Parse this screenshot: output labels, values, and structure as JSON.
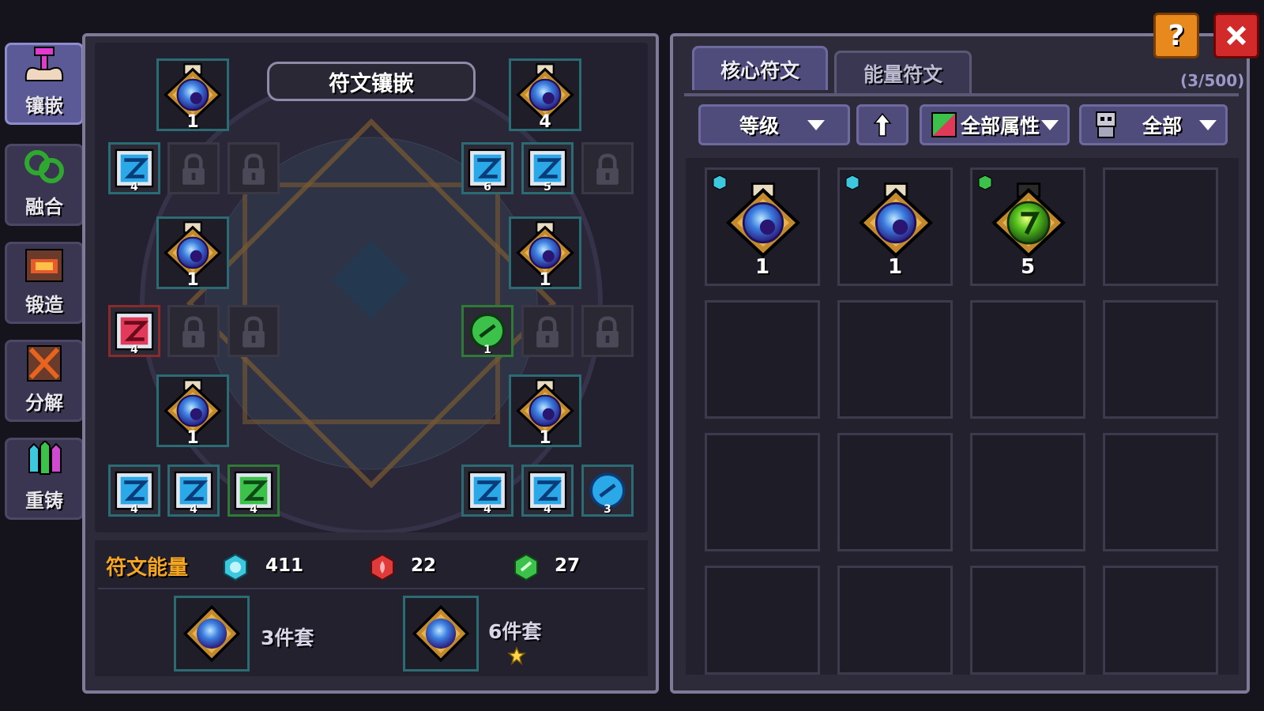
{
  "sidebar": {
    "items": [
      {
        "label": "镶嵌",
        "icon": "inlay-icon",
        "active": true
      },
      {
        "label": "融合",
        "icon": "fusion-icon",
        "active": false
      },
      {
        "label": "锻造",
        "icon": "forge-icon",
        "active": false
      },
      {
        "label": "分解",
        "icon": "decompose-icon",
        "active": false
      },
      {
        "label": "重铸",
        "icon": "recast-icon",
        "active": false
      }
    ]
  },
  "inlay_panel": {
    "title": "符文镶嵌",
    "core_levels": [
      "1",
      "4",
      "1",
      "1",
      "1",
      "1"
    ],
    "slot_levels": {
      "row1_left": [
        "4"
      ],
      "row1_right": [
        "6",
        "5"
      ],
      "row2_left": [
        "4"
      ],
      "row2_right": [
        "1"
      ],
      "row3_left": [
        "4",
        "4",
        "4"
      ],
      "row3_right": [
        "4",
        "4",
        "3"
      ]
    }
  },
  "energy": {
    "label": "符文能量",
    "blue": "411",
    "red": "22",
    "green": "27"
  },
  "sets": [
    {
      "label": "3件套"
    },
    {
      "label": "6件套"
    }
  ],
  "rune_panel": {
    "tabs": [
      {
        "label": "核心符文",
        "active": true
      },
      {
        "label": "能量符文",
        "active": false
      }
    ],
    "count": "(3/500)",
    "filters": {
      "sort": "等级",
      "attribute": "全部属性",
      "type": "全部"
    },
    "runes": [
      {
        "level": "1",
        "color": "blue"
      },
      {
        "level": "1",
        "color": "blue"
      },
      {
        "level": "5",
        "color": "green"
      }
    ]
  },
  "colors": {
    "accent_orange": "#f5a623",
    "blue_energy": "#3ec8e0",
    "red_energy": "#e03a3a",
    "green_energy": "#3cc24a"
  }
}
